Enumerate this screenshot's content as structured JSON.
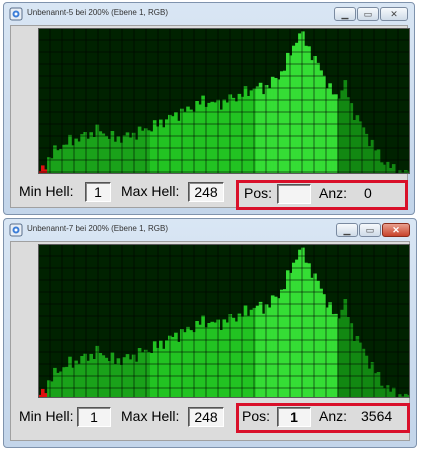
{
  "windows": [
    {
      "title": "Unbenannt-5 bei 200% (Ebene 1, RGB)",
      "min_label": "Min Hell:",
      "min_value": "1",
      "max_label": "Max Hell:",
      "max_value": "248",
      "pos_label": "Pos:",
      "pos_value": "",
      "anz_label": "Anz:",
      "anz_value": "0",
      "highlight_color": "#d9102a",
      "histogram_color": "#00b400"
    },
    {
      "title": "Unbenannt-7 bei 200% (Ebene 1, RGB)",
      "min_label": "Min Hell:",
      "min_value": "1",
      "max_label": "Max Hell:",
      "max_value": "248",
      "pos_label": "Pos:",
      "pos_value": "1",
      "anz_label": "Anz:",
      "anz_value": "3564",
      "highlight_color": "#d9102a",
      "histogram_color": "#00b400"
    }
  ]
}
